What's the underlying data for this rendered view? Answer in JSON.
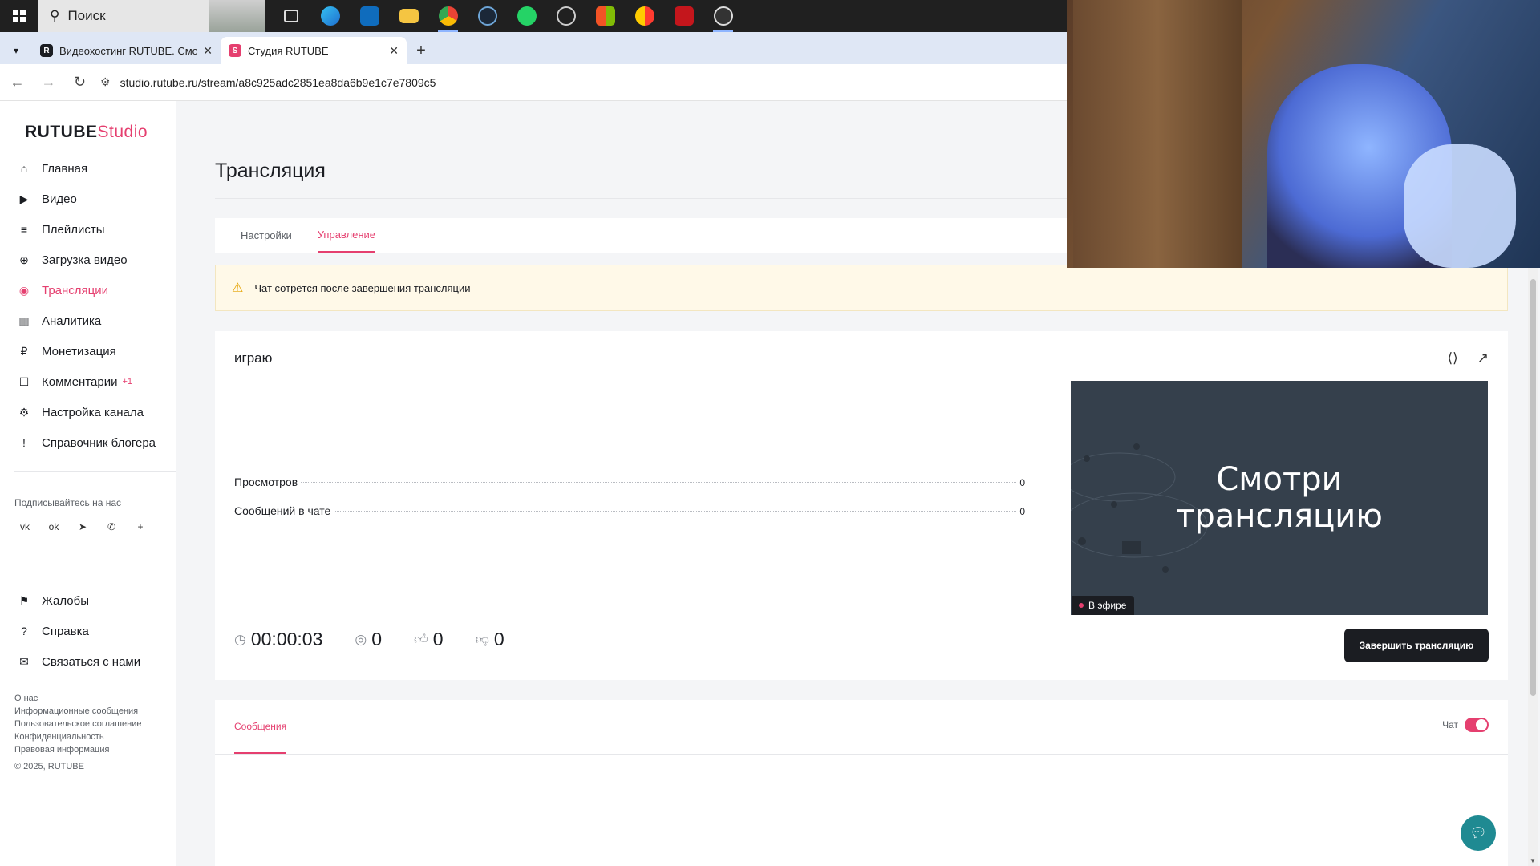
{
  "taskbar": {
    "search_label": "Поиск",
    "icons": [
      "task-view-icon",
      "edge-icon",
      "outlook-icon",
      "file-explorer-icon",
      "chrome-icon",
      "steam-icon",
      "whatsapp-icon",
      "app-icon",
      "store-icon",
      "app-icon-2",
      "ts-icon",
      "obs-icon"
    ]
  },
  "browser": {
    "tabs": [
      {
        "title": "Видеохостинг RUTUBE. Смотр",
        "favicon": "R",
        "close": "✕"
      },
      {
        "title": "Студия RUTUBE",
        "favicon": "S",
        "close": "✕"
      }
    ],
    "new_tab": "+",
    "url": "studio.rutube.ru/stream/a8c925adc2851ea8da6b9e1c7e7809c5"
  },
  "sidebar": {
    "logo_main": "RUTUBE",
    "logo_studio": "Studio",
    "items": [
      {
        "label": "Главная",
        "icon": "home-icon",
        "glyph": "⌂"
      },
      {
        "label": "Видео",
        "icon": "video-icon",
        "glyph": "▶"
      },
      {
        "label": "Плейлисты",
        "icon": "playlist-icon",
        "glyph": "≡"
      },
      {
        "label": "Загрузка видео",
        "icon": "upload-icon",
        "glyph": "⊕"
      },
      {
        "label": "Трансляции",
        "icon": "broadcast-icon",
        "glyph": "◉"
      },
      {
        "label": "Аналитика",
        "icon": "analytics-icon",
        "glyph": "▥"
      },
      {
        "label": "Монетизация",
        "icon": "monetization-icon",
        "glyph": "₽"
      },
      {
        "label": "Комментарии",
        "icon": "comments-icon",
        "glyph": "☐",
        "badge": "+1"
      },
      {
        "label": "Настройка канала",
        "icon": "settings-icon",
        "glyph": "⚙"
      },
      {
        "label": "Справочник блогера",
        "icon": "guide-icon",
        "glyph": "!"
      }
    ],
    "follow_label": "Подписывайтесь на нас",
    "socials": [
      {
        "name": "vk-icon",
        "glyph": "vk"
      },
      {
        "name": "ok-icon",
        "glyph": "ok"
      },
      {
        "name": "telegram-icon",
        "glyph": "➤"
      },
      {
        "name": "viber-icon",
        "glyph": "✆"
      },
      {
        "name": "more-icon",
        "glyph": "+"
      }
    ],
    "items2": [
      {
        "label": "Жалобы",
        "icon": "flag-icon",
        "glyph": "⚑"
      },
      {
        "label": "Справка",
        "icon": "help-icon",
        "glyph": "?"
      },
      {
        "label": "Связаться с нами",
        "icon": "mail-icon",
        "glyph": "✉"
      }
    ],
    "footer_links": [
      "О нас",
      "Информационные сообщения",
      "Пользовательское соглашение",
      "Конфиденциальность",
      "Правовая информация"
    ],
    "copyright": "© 2025, RUTUBE"
  },
  "main": {
    "title": "Трансляция",
    "tabs": [
      "Настройки",
      "Управление"
    ],
    "alert": "Чат сотрётся после завершения трансляции",
    "stream": {
      "title": "играю",
      "stats": [
        {
          "label": "Просмотров",
          "value": "0"
        },
        {
          "label": "Сообщений в чате",
          "value": "0"
        }
      ],
      "preview_text_1": "Смотри",
      "preview_text_2": "трансляцию",
      "live_label": "В эфире",
      "timer": "00:00:03",
      "viewers": "0",
      "likes": "0",
      "dislikes": "0",
      "end_button": "Завершить трансляцию"
    },
    "chat": {
      "tab": "Сообщения",
      "toggle_label": "Чат",
      "enabled": true
    }
  },
  "colors": {
    "accent": "#e53f6f",
    "dark": "#1b1d22",
    "alert_bg": "#fff9e8",
    "fab": "#1f8a92"
  }
}
